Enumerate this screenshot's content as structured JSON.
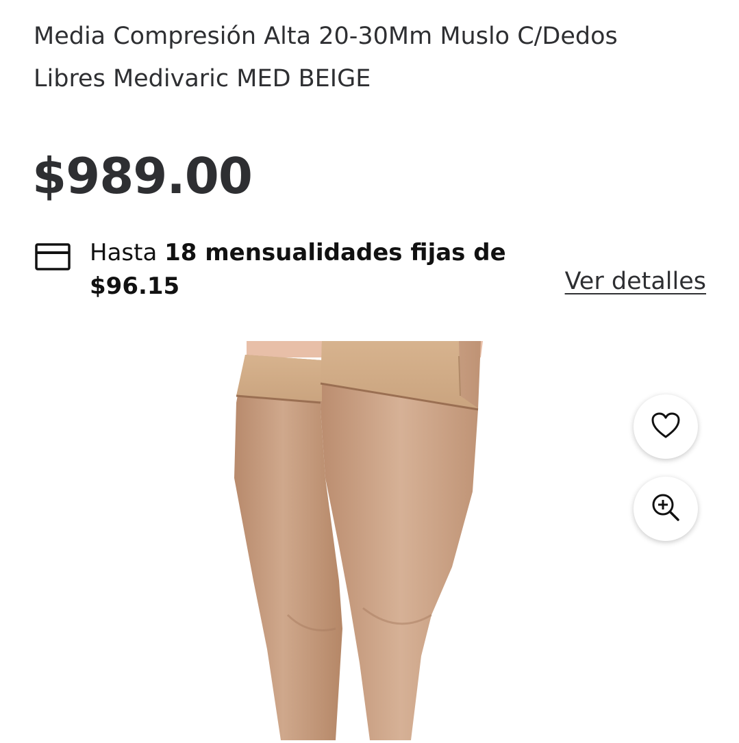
{
  "product": {
    "title": "Media Compresión Alta 20-30Mm Muslo C/Dedos Libres Medivaric MED BEIGE",
    "price": "$989.00"
  },
  "installments": {
    "prefix": "Hasta ",
    "bold_text": "18 mensualidades fijas de",
    "amount": "$96.15",
    "details_link": "Ver detalles",
    "icon": "credit-card-icon"
  },
  "actions": {
    "favorite_icon": "heart-icon",
    "zoom_icon": "zoom-in-icon"
  },
  "image": {
    "subject": "beige thigh-high compression stockings on legs"
  },
  "colors": {
    "text": "#2e2f32",
    "stocking": "#c9a183"
  }
}
